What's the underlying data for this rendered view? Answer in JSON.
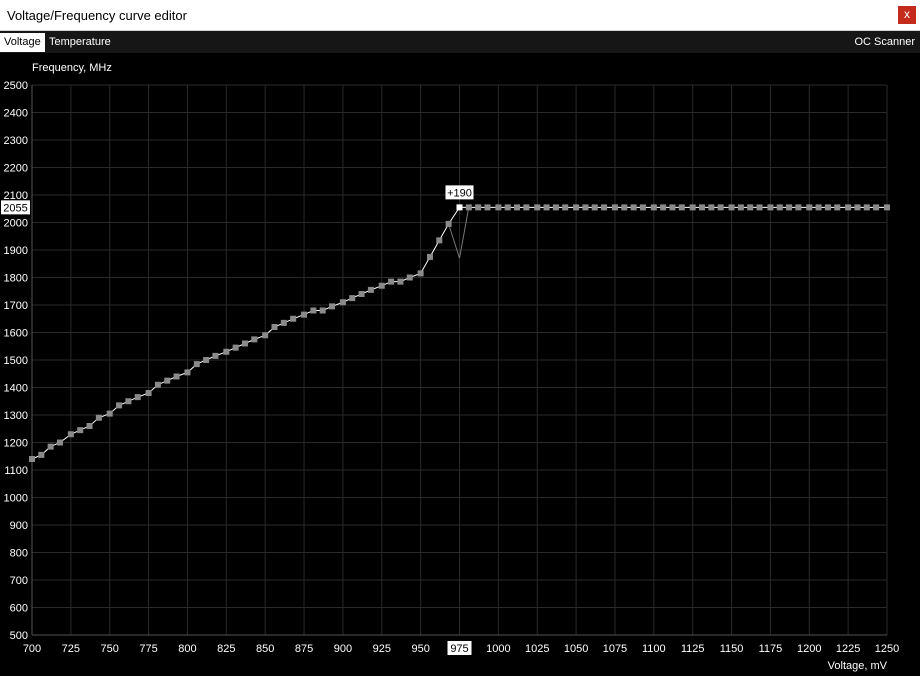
{
  "window": {
    "title": "Voltage/Frequency curve editor",
    "close_label": "x"
  },
  "tabs": {
    "voltage": "Voltage",
    "temperature": "Temperature",
    "oc_scanner": "OC Scanner"
  },
  "colors": {
    "background": "#000000",
    "grid": "#2a2a2a",
    "curve": "#ffffff",
    "point": "#8a8a8a",
    "selected_point": "#ffffff",
    "close_button": "#c42b1c"
  },
  "chart_data": {
    "type": "line",
    "ylabel": "Frequency, MHz",
    "xlabel": "Voltage, mV",
    "xlim": [
      700,
      1250
    ],
    "ylim": [
      500,
      2500
    ],
    "xticks": [
      700,
      725,
      750,
      775,
      800,
      825,
      850,
      875,
      900,
      925,
      950,
      975,
      1000,
      1025,
      1050,
      1075,
      1100,
      1125,
      1150,
      1175,
      1200,
      1225,
      1250
    ],
    "yticks": [
      500,
      600,
      700,
      800,
      900,
      1000,
      1100,
      1200,
      1300,
      1400,
      1500,
      1600,
      1700,
      1800,
      1900,
      2000,
      2100,
      2200,
      2300,
      2400,
      2500
    ],
    "grid": true,
    "highlight": {
      "x_label": "975",
      "y_label": "2055",
      "offset_label": "+190"
    },
    "series": [
      {
        "x": [
          700,
          706,
          712,
          718,
          725,
          731,
          737,
          743,
          750,
          756,
          762,
          768,
          775,
          781,
          787,
          793,
          800,
          806,
          812,
          818,
          825,
          831,
          837,
          843,
          850,
          856,
          862,
          868,
          875,
          881,
          887,
          893,
          900,
          906,
          912,
          918,
          925,
          931,
          937,
          943,
          950,
          956,
          962,
          968,
          975,
          981,
          987,
          993,
          1000,
          1006,
          1012,
          1018,
          1025,
          1031,
          1037,
          1043,
          1050,
          1056,
          1062,
          1068,
          1075,
          1081,
          1087,
          1093,
          1100,
          1106,
          1112,
          1118,
          1125,
          1131,
          1137,
          1143,
          1150,
          1156,
          1162,
          1168,
          1175,
          1181,
          1187,
          1193,
          1200,
          1206,
          1212,
          1218,
          1225,
          1231,
          1237,
          1243,
          1250
        ],
        "values": [
          1140,
          1155,
          1185,
          1200,
          1230,
          1245,
          1260,
          1290,
          1305,
          1335,
          1350,
          1365,
          1380,
          1410,
          1425,
          1440,
          1455,
          1485,
          1500,
          1515,
          1530,
          1545,
          1560,
          1575,
          1590,
          1620,
          1635,
          1650,
          1665,
          1680,
          1680,
          1695,
          1710,
          1725,
          1740,
          1755,
          1770,
          1785,
          1785,
          1800,
          1815,
          1875,
          1935,
          1995,
          2055,
          2055,
          2055,
          2055,
          2055,
          2055,
          2055,
          2055,
          2055,
          2055,
          2055,
          2055,
          2055,
          2055,
          2055,
          2055,
          2055,
          2055,
          2055,
          2055,
          2055,
          2055,
          2055,
          2055,
          2055,
          2055,
          2055,
          2055,
          2055,
          2055,
          2055,
          2055,
          2055,
          2055,
          2055,
          2055,
          2055,
          2055,
          2055,
          2055,
          2055,
          2055,
          2055,
          2055,
          2055
        ]
      },
      {
        "x": [
          968,
          975,
          981
        ],
        "values": [
          1995,
          1870,
          2055
        ]
      }
    ]
  }
}
